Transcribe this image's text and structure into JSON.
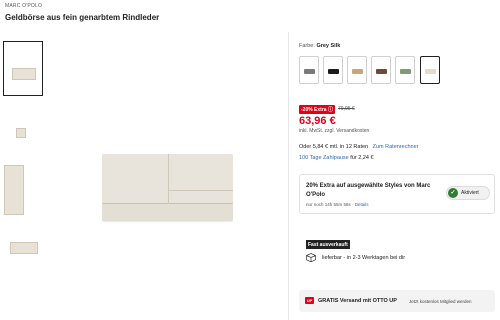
{
  "product": {
    "brand": "MARC O'POLO",
    "title": "Geldbörse aus fein genarbtem Rindleder"
  },
  "gallery": {
    "thumbnails": [
      {
        "name": "front",
        "active": true
      },
      {
        "name": "detail",
        "active": false
      },
      {
        "name": "side",
        "active": false
      },
      {
        "name": "back",
        "active": false
      }
    ]
  },
  "color": {
    "label": "Farbe:",
    "selected": "Grey Silk",
    "swatches": [
      {
        "color": "#7a7a7a"
      },
      {
        "color": "#1c1c1c"
      },
      {
        "color": "#c9a57a"
      },
      {
        "color": "#6b4a3a"
      },
      {
        "color": "#7f9a76"
      },
      {
        "color": "#e4dcc8"
      }
    ]
  },
  "pricing": {
    "extra_badge": "-20% Extra ⓘ",
    "old_price": "79,95 €",
    "price": "63,96 €",
    "vat": "inkl. MwSt. zzgl. Versandkosten",
    "installment_text": "Oder 5,84 € mtl. in 12 Raten",
    "installment_link": "Zum Ratenrechner",
    "pause_link": "100 Tage Zahlpause",
    "pause_text": " für 2,24 €"
  },
  "promo": {
    "title": "20% Extra auf ausgewählte Styles von Marc O'Polo",
    "countdown": "nur noch 14h 55m 58s · ",
    "details_link": "Details",
    "status": "Aktiviert"
  },
  "delivery": {
    "badge": "Fast ausverkauft",
    "text": "lieferbar - in 2-3 Werktagen bei dir"
  },
  "shipping": {
    "logo": "UP",
    "text": "GRATIS Versand mit OTTO UP",
    "sub": "Jetzt kostenlos Mitglied werden"
  },
  "colors": {
    "sale_red": "#e2001a",
    "link_blue": "#2a6ab5",
    "active_green": "#2e7d32"
  }
}
